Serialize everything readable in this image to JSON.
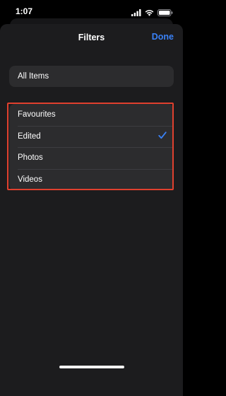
{
  "status_bar": {
    "time": "1:07",
    "icons": [
      "cellular-signal-icon",
      "wifi-icon",
      "battery-icon"
    ]
  },
  "nav": {
    "title": "Filters",
    "done_label": "Done"
  },
  "all_items": {
    "label": "All Items"
  },
  "filters": [
    {
      "label": "Favourites",
      "selected": false
    },
    {
      "label": "Edited",
      "selected": true
    },
    {
      "label": "Photos",
      "selected": false
    },
    {
      "label": "Videos",
      "selected": false
    }
  ],
  "colors": {
    "accent": "#3a82f7",
    "highlight_box": "#e0402e",
    "sheet_background": "#1c1c1e",
    "row_background": "#2c2c2e"
  }
}
